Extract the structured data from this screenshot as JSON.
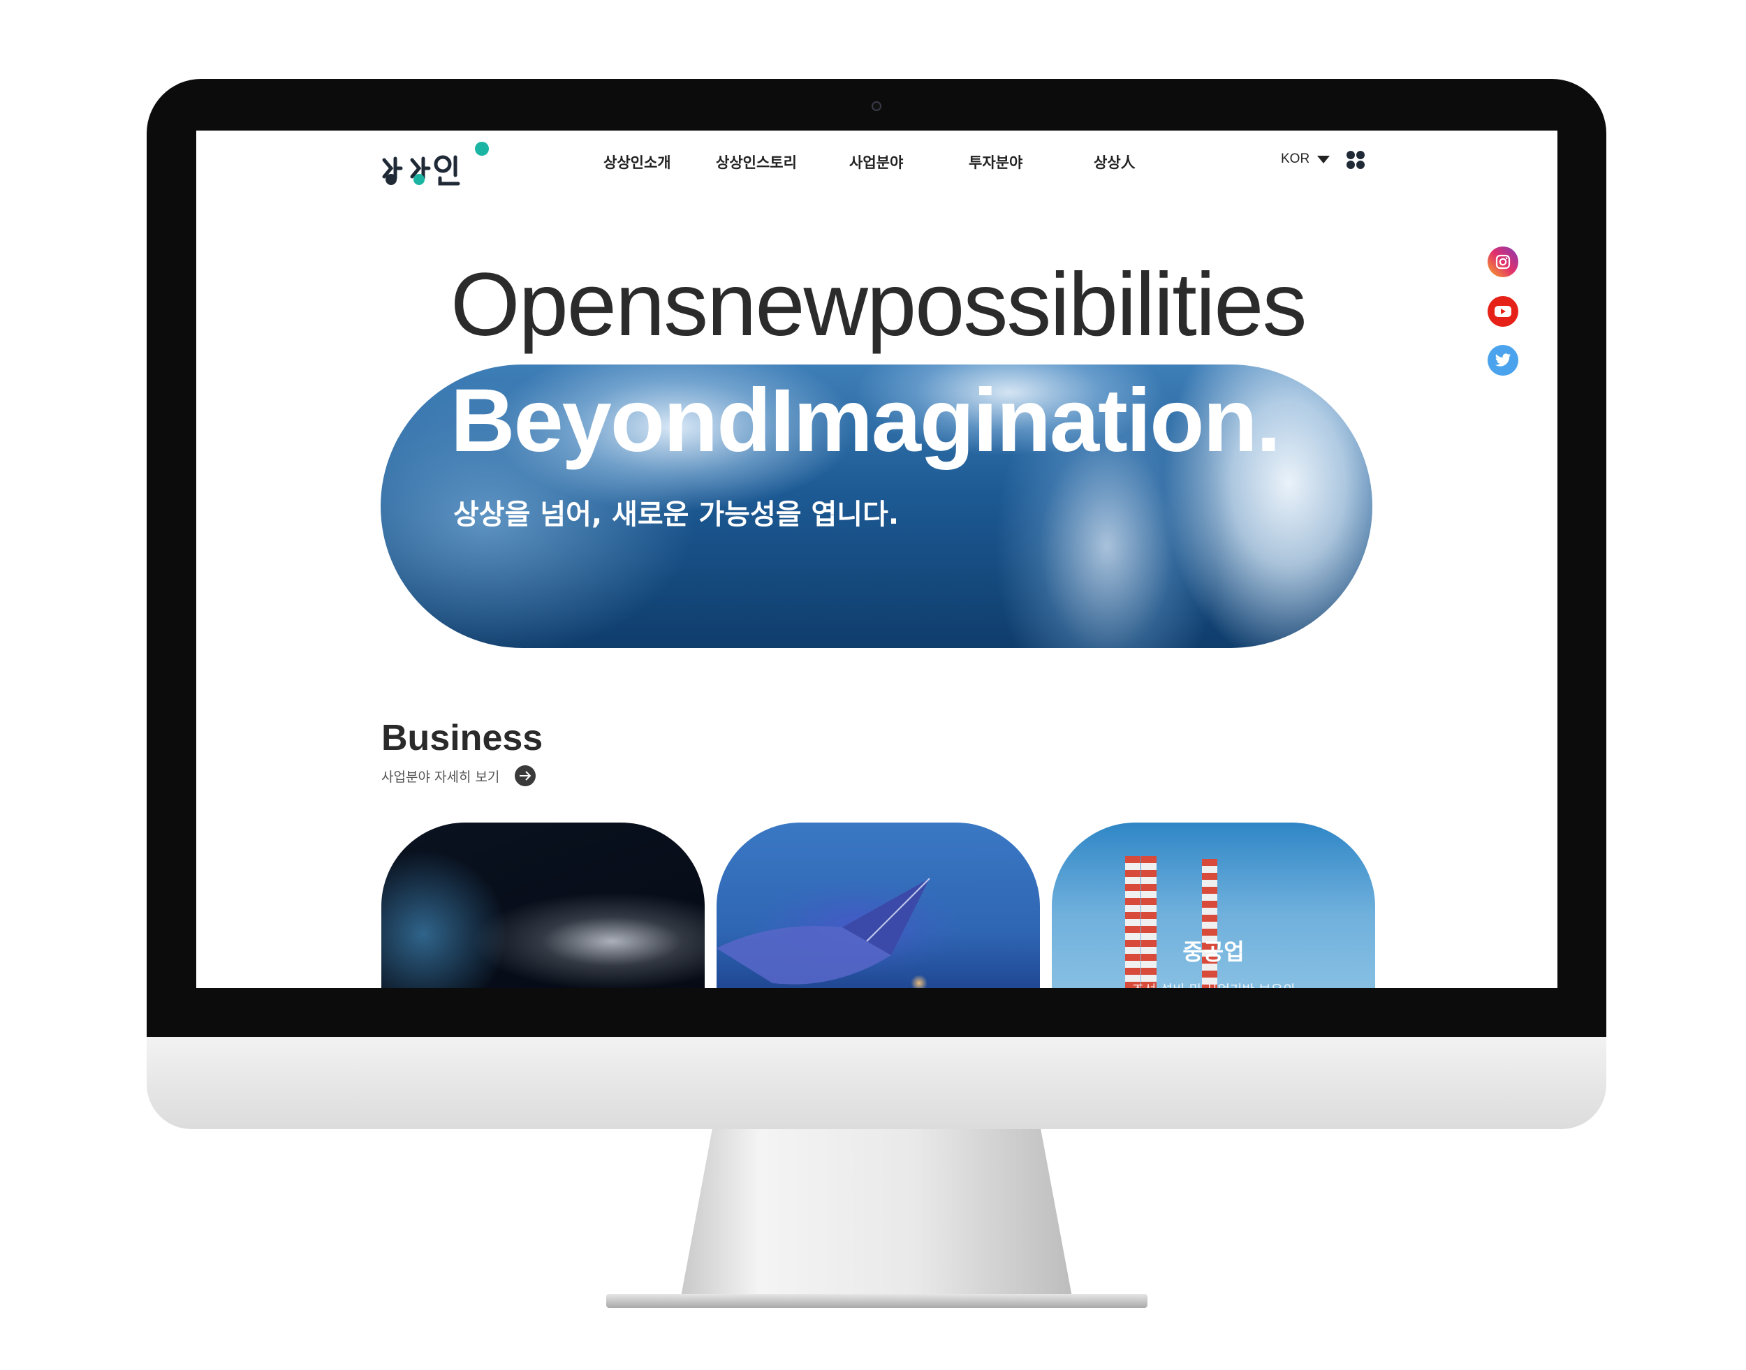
{
  "logo": {
    "text": "상상인",
    "accent_color": "#1cb5a3"
  },
  "nav": {
    "items": [
      {
        "label": "상상인소개"
      },
      {
        "label": "상상인스토리"
      },
      {
        "label": "사업분야"
      },
      {
        "label": "투자분야"
      },
      {
        "label": "상상人"
      }
    ]
  },
  "language": {
    "selected": "KOR",
    "icon": "caret-down-icon"
  },
  "menu_icon": "grid-menu-icon",
  "social": [
    {
      "name": "instagram-icon",
      "color": "#c837ab"
    },
    {
      "name": "youtube-icon",
      "color": "#e62117"
    },
    {
      "name": "twitter-icon",
      "color": "#4aa3ec"
    }
  ],
  "hero": {
    "line1": "Opensnewpossibilities",
    "line2": "BeyondImagination.",
    "subtitle": "상상을 넘어, 새로운 가능성을 엽니다."
  },
  "business": {
    "title": "Business",
    "link_label": "사업분야 자세히 보기",
    "cards": [
      {
        "label": ""
      },
      {
        "label": ""
      },
      {
        "label": "중공업",
        "sub": "조선 설비 및 사업기반 보유의"
      }
    ]
  }
}
